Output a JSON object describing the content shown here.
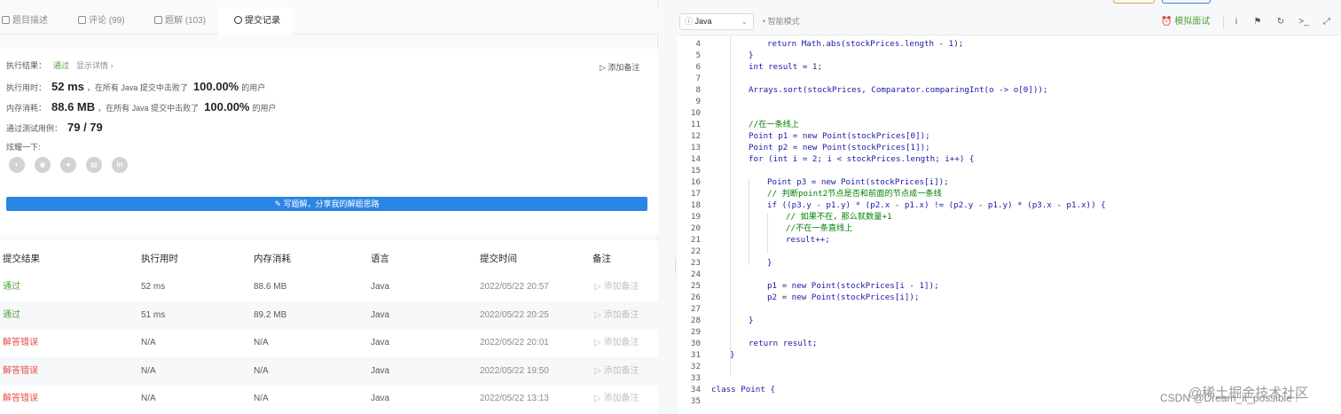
{
  "tabs": [
    {
      "label": "题目描述",
      "icon": "description-icon"
    },
    {
      "label": "评论 (99)",
      "icon": "comment-icon"
    },
    {
      "label": "题解 (103)",
      "icon": "flask-icon"
    },
    {
      "label": "提交记录",
      "icon": "clock-icon"
    }
  ],
  "result": {
    "status_label": "执行结果：",
    "status": "通过",
    "show_detail": "显示详情 ›",
    "add_note": "▷ 添加备注",
    "runtime_label": "执行用时：",
    "runtime_value": "52 ms",
    "runtime_text": "，在所有 Java 提交中击败了",
    "runtime_percent": "100.00%",
    "runtime_suffix": "的用户",
    "memory_label": "内存消耗：",
    "memory_value": "88.6 MB",
    "memory_text": "，在所有 Java 提交中击败了",
    "memory_percent": "100.00%",
    "memory_suffix": "的用户",
    "tests_label": "通过测试用例：",
    "tests_value": "79  /  79",
    "share_label": "炫耀一下:",
    "share_icons": [
      "wechat-icon",
      "weibo-icon",
      "qq-icon",
      "douban-icon",
      "linkedin-icon"
    ],
    "write_button": "✎ 写题解，分享我的解题思路"
  },
  "history": {
    "headers": [
      "提交结果",
      "执行用时",
      "内存消耗",
      "语言",
      "提交时间",
      "备注"
    ],
    "rows": [
      {
        "result": "通过",
        "status": "ok",
        "time": "52 ms",
        "memory": "88.6 MB",
        "lang": "Java",
        "date": "2022/05/22 20:57",
        "remark": "▷ 添加备注"
      },
      {
        "result": "通过",
        "status": "ok",
        "time": "51 ms",
        "memory": "89.2 MB",
        "lang": "Java",
        "date": "2022/05/22 20:25",
        "remark": "▷ 添加备注"
      },
      {
        "result": "解答错误",
        "status": "err",
        "time": "N/A",
        "memory": "N/A",
        "lang": "Java",
        "date": "2022/05/22 20:01",
        "remark": "▷ 添加备注"
      },
      {
        "result": "解答错误",
        "status": "err",
        "time": "N/A",
        "memory": "N/A",
        "lang": "Java",
        "date": "2022/05/22 19:50",
        "remark": "▷ 添加备注"
      },
      {
        "result": "解答错误",
        "status": "err",
        "time": "N/A",
        "memory": "N/A",
        "lang": "Java",
        "date": "2022/05/22 13:13",
        "remark": "▷ 添加备注"
      }
    ]
  },
  "toolbar": {
    "language": "Java",
    "smart_mode": "智能模式",
    "mock_interview": "模拟面试",
    "icons": [
      "info-icon",
      "flag-icon",
      "reset-icon",
      "console-icon",
      "fullscreen-icon"
    ]
  },
  "code": {
    "lines": [
      {
        "n": "4",
        "indent": 3,
        "text": "return Math.abs(stockPrices.length - 1);",
        "kind": "code"
      },
      {
        "n": "5",
        "indent": 2,
        "text": "}",
        "kind": "code"
      },
      {
        "n": "6",
        "indent": 2,
        "text": "int result = 1;",
        "kind": "code"
      },
      {
        "n": "7",
        "indent": 0,
        "text": "",
        "kind": "code"
      },
      {
        "n": "8",
        "indent": 2,
        "text": "Arrays.sort(stockPrices, Comparator.comparingInt(o -> o[0]));",
        "kind": "code"
      },
      {
        "n": "9",
        "indent": 0,
        "text": "",
        "kind": "code"
      },
      {
        "n": "10",
        "indent": 0,
        "text": "",
        "kind": "code"
      },
      {
        "n": "11",
        "indent": 2,
        "text": "//在一条线上",
        "kind": "comment"
      },
      {
        "n": "12",
        "indent": 2,
        "text": "Point p1 = new Point(stockPrices[0]);",
        "kind": "code"
      },
      {
        "n": "13",
        "indent": 2,
        "text": "Point p2 = new Point(stockPrices[1]);",
        "kind": "code"
      },
      {
        "n": "14",
        "indent": 2,
        "text": "for (int i = 2; i < stockPrices.length; i++) {",
        "kind": "code"
      },
      {
        "n": "15",
        "indent": 0,
        "text": "",
        "kind": "code"
      },
      {
        "n": "16",
        "indent": 3,
        "text": "Point p3 = new Point(stockPrices[i]);",
        "kind": "code"
      },
      {
        "n": "17",
        "indent": 3,
        "text": "// 判断point2节点是否和前面的节点成一条线",
        "kind": "comment"
      },
      {
        "n": "18",
        "indent": 3,
        "text": "if ((p3.y - p1.y) * (p2.x - p1.x) != (p2.y - p1.y) * (p3.x - p1.x)) {",
        "kind": "code"
      },
      {
        "n": "19",
        "indent": 4,
        "text": "// 如果不在，那么就数量+1",
        "kind": "comment"
      },
      {
        "n": "20",
        "indent": 4,
        "text": "//不在一条直线上",
        "kind": "comment"
      },
      {
        "n": "21",
        "indent": 4,
        "text": "result++;",
        "kind": "code"
      },
      {
        "n": "22",
        "indent": 0,
        "text": "",
        "kind": "code"
      },
      {
        "n": "23",
        "indent": 3,
        "text": "}",
        "kind": "code"
      },
      {
        "n": "24",
        "indent": 0,
        "text": "",
        "kind": "code"
      },
      {
        "n": "25",
        "indent": 3,
        "text": "p1 = new Point(stockPrices[i - 1]);",
        "kind": "code"
      },
      {
        "n": "26",
        "indent": 3,
        "text": "p2 = new Point(stockPrices[i]);",
        "kind": "code"
      },
      {
        "n": "27",
        "indent": 0,
        "text": "",
        "kind": "code"
      },
      {
        "n": "28",
        "indent": 2,
        "text": "}",
        "kind": "code"
      },
      {
        "n": "29",
        "indent": 0,
        "text": "",
        "kind": "code"
      },
      {
        "n": "30",
        "indent": 2,
        "text": "return result;",
        "kind": "code"
      },
      {
        "n": "31",
        "indent": 1,
        "text": "}",
        "kind": "code"
      },
      {
        "n": "32",
        "indent": 0,
        "text": "",
        "kind": "code"
      },
      {
        "n": "33",
        "indent": 0,
        "text": "",
        "kind": "code"
      },
      {
        "n": "34",
        "indent": 0,
        "text": "class Point {",
        "kind": "code"
      },
      {
        "n": "35",
        "indent": 0,
        "text": "",
        "kind": "code"
      }
    ]
  },
  "watermark": "CSDN @Dream_it_possible !",
  "watermark2": "@稀土掘金技术社区"
}
